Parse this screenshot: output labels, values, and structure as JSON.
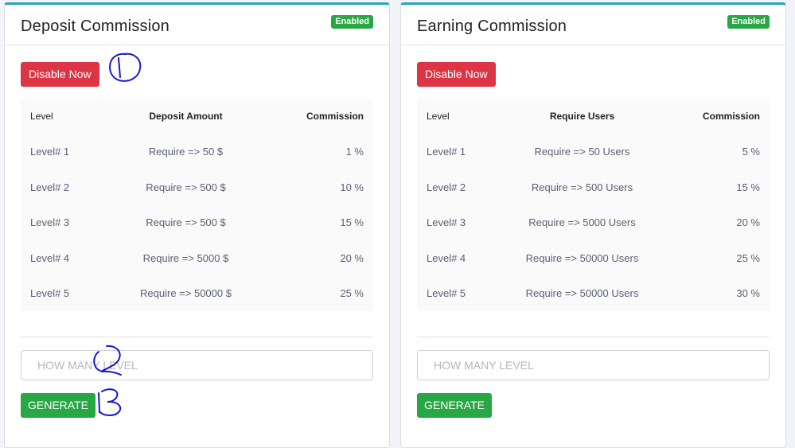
{
  "cards": [
    {
      "title": "Deposit Commission",
      "status_badge": "Enabled",
      "action_button": "Disable Now",
      "columns": [
        "Level",
        "Deposit Amount",
        "Commission"
      ],
      "rows": [
        {
          "level": "Level# 1",
          "requirement": "Require => 50 $",
          "commission": "1 %"
        },
        {
          "level": "Level# 2",
          "requirement": "Require => 500 $",
          "commission": "10 %"
        },
        {
          "level": "Level# 3",
          "requirement": "Require => 500 $",
          "commission": "15 %"
        },
        {
          "level": "Level# 4",
          "requirement": "Require => 5000 $",
          "commission": "20 %"
        },
        {
          "level": "Level# 5",
          "requirement": "Require => 50000 $",
          "commission": "25 %"
        }
      ],
      "input": {
        "placeholder": "HOW MANY LEVEL",
        "value": ""
      },
      "generate_button": "GENERATE"
    },
    {
      "title": "Earning Commission",
      "status_badge": "Enabled",
      "action_button": "Disable Now",
      "columns": [
        "Level",
        "Require Users",
        "Commission"
      ],
      "rows": [
        {
          "level": "Level# 1",
          "requirement": "Require => 50 Users",
          "commission": "5 %"
        },
        {
          "level": "Level# 2",
          "requirement": "Require => 500 Users",
          "commission": "15 %"
        },
        {
          "level": "Level# 3",
          "requirement": "Require => 5000 Users",
          "commission": "20 %"
        },
        {
          "level": "Level# 4",
          "requirement": "Require => 50000 Users",
          "commission": "25 %"
        },
        {
          "level": "Level# 5",
          "requirement": "Require => 50000 Users",
          "commission": "30 %"
        }
      ],
      "input": {
        "placeholder": "HOW MANY LEVEL",
        "value": ""
      },
      "generate_button": "GENERATE"
    }
  ],
  "annotations": [
    "1",
    "2",
    "3"
  ],
  "colors": {
    "accent_top": "#27a6ba",
    "danger": "#dc3545",
    "success": "#28a745",
    "annotation_ink": "#1515e0"
  }
}
